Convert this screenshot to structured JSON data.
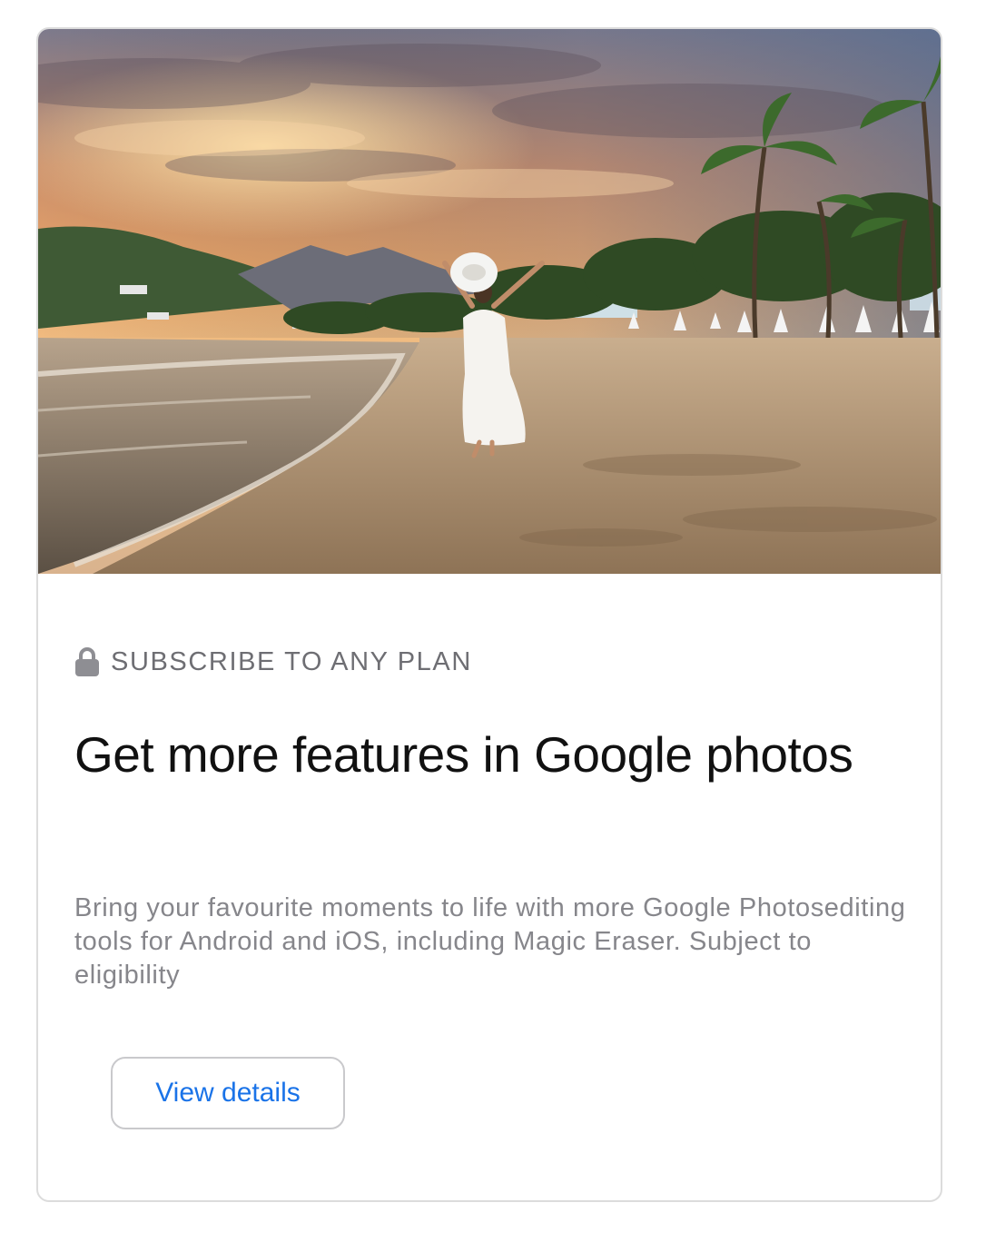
{
  "card": {
    "image_icon": "beach-sunset-photo",
    "eyebrow_icon": "lock-icon",
    "eyebrow": "SUBSCRIBE TO ANY PLAN",
    "title": "Get more features in Google photos",
    "description": "Bring your favourite moments to life with more Google Photosediting tools for Android and iOS, including Magic Eraser. Subject to eligibility",
    "button_label": "View details"
  },
  "colors": {
    "accent": "#1a73e8",
    "eyebrow_text": "#6e6e73",
    "body_text": "#86868b",
    "border": "#dcdcdc"
  }
}
